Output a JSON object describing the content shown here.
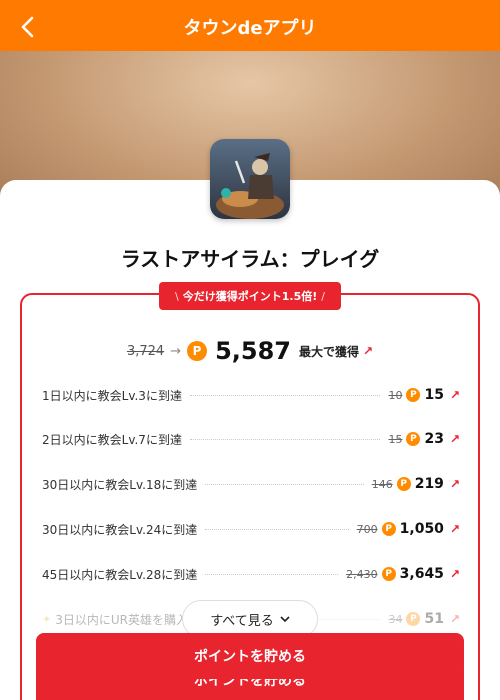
{
  "header": {
    "title": "タウンdeアプリ",
    "back_icon": "chevron-left-icon"
  },
  "app": {
    "name": "ラストアサイラム：プレイグ"
  },
  "promo": {
    "badge": "今だけ獲得ポイント1.5倍!"
  },
  "total": {
    "old": "3,724",
    "new": "5,587",
    "label": "最大で獲得",
    "coin": "P"
  },
  "tasks": [
    {
      "label": "1日以内に教会Lv.3に到達",
      "old": "10",
      "new": "15"
    },
    {
      "label": "2日以内に教会Lv.7に到達",
      "old": "15",
      "new": "23"
    },
    {
      "label": "30日以内に教会Lv.18に到達",
      "old": "146",
      "new": "219"
    },
    {
      "label": "30日以内に教会Lv.24に到達",
      "old": "700",
      "new": "1,050"
    },
    {
      "label": "45日以内に教会Lv.28に到達",
      "old": "2,430",
      "new": "3,645"
    },
    {
      "label": "3日以内にUR英雄を購入",
      "old": "34",
      "new": "51"
    }
  ],
  "see_all": {
    "label": "すべて見る"
  },
  "cta": {
    "label": "ポイントを貯める"
  },
  "colors": {
    "header": "#ff7a00",
    "accent_red": "#e8242f",
    "coin": "#ff8c00"
  }
}
